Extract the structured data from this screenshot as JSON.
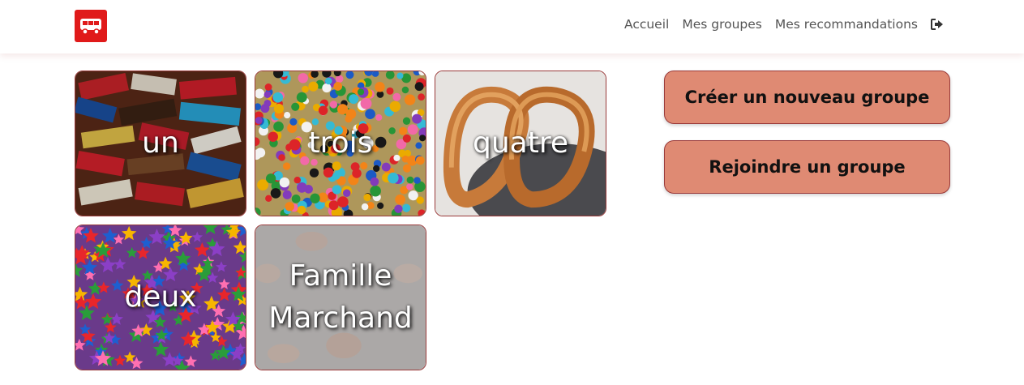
{
  "nav": {
    "logo_icon": "bus-icon",
    "brand_color": "#e01a1a",
    "links": [
      "Accueil",
      "Mes groupes",
      "Mes recommandations"
    ],
    "logout_icon": "sign-out-icon"
  },
  "groups": [
    {
      "name": "un",
      "image": "chocolate-bars"
    },
    {
      "name": "trois",
      "image": "colorful-candy-beads"
    },
    {
      "name": "quatre",
      "image": "churros"
    },
    {
      "name": "deux",
      "image": "star-sprinkles"
    },
    {
      "name": "Famille Marchand",
      "image": "macarons"
    }
  ],
  "actions": {
    "create_label": "Créer un nouveau groupe",
    "join_label": "Rejoindre un groupe",
    "button_color": "#df8a73"
  }
}
